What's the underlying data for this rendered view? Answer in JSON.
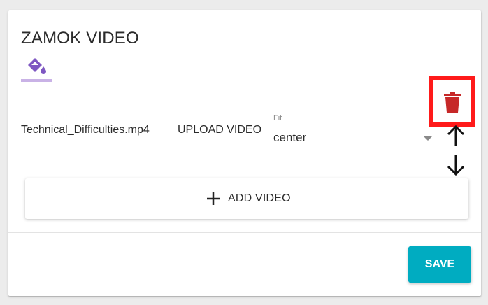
{
  "section": {
    "title": "ZAMOK VIDEO"
  },
  "video_item": {
    "filename": "Technical_Difficulties.mp4",
    "upload_label": "UPLOAD VIDEO",
    "fit": {
      "label": "Fit",
      "value": "center"
    }
  },
  "actions": {
    "add_video_label": "ADD VIDEO",
    "save_label": "SAVE"
  },
  "colors": {
    "accent_purple": "#7e57c2",
    "paint_underline": "#c9b2e6",
    "delete_red": "#c62828",
    "highlight_red": "#ff1a1a",
    "save_teal": "#00acc1"
  },
  "icons": {
    "paint": "format-color-fill-icon",
    "delete": "trash-icon",
    "move_up": "arrow-up-icon",
    "move_down": "arrow-down-icon",
    "add": "plus-icon",
    "select": "chevron-down-icon"
  }
}
